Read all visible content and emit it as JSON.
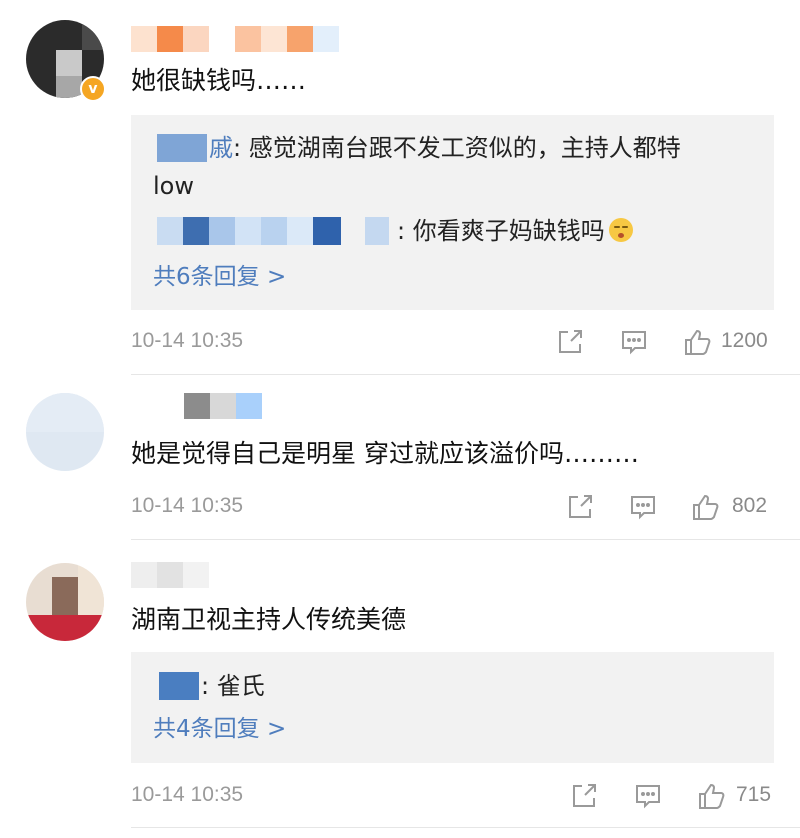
{
  "colors": {
    "link_blue": "#4f7dbd",
    "meta_gray": "#9a9a9a",
    "reply_bg": "#f2f2f2",
    "badge_orange": "#f5a623"
  },
  "comments": [
    {
      "text": "她很缺钱吗……",
      "verified": true,
      "badge_icon": "verified-v-icon",
      "replies": [
        {
          "name_visible": "戚",
          "text": ": 感觉湖南台跟不发工资似的，主持人都特",
          "text_cont": "low"
        },
        {
          "name_visible": "",
          "text": ": 你看爽子妈缺钱吗"
        }
      ],
      "more_replies": "共6条回复 >",
      "time": "10-14 10:35",
      "likes": "1200"
    },
    {
      "text": "她是觉得自己是明星 穿过就应该溢价吗………",
      "verified": false,
      "replies": [],
      "more_replies": "",
      "time": "10-14 10:35",
      "likes": "802"
    },
    {
      "text": "湖南卫视主持人传统美德",
      "verified": false,
      "replies": [
        {
          "name_visible": "",
          "text": ": 雀氏"
        }
      ],
      "more_replies": "共4条回复 >",
      "time": "10-14 10:35",
      "likes": "715"
    }
  ],
  "icons": {
    "share": "share-icon",
    "comment": "comment-icon",
    "like": "thumbs-up-icon",
    "emoji": "shush-emoji-icon"
  }
}
